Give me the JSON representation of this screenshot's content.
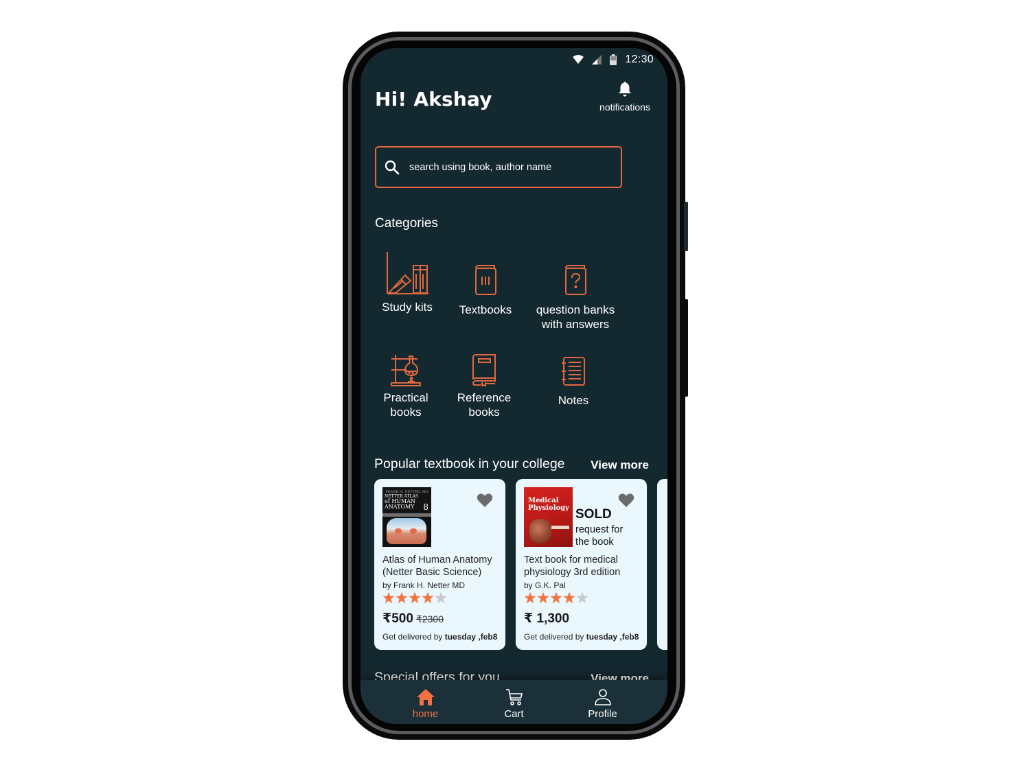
{
  "status_bar": {
    "time": "12:30",
    "icons": [
      "wifi-icon",
      "cell-signal-icon",
      "battery-icon"
    ]
  },
  "header": {
    "greeting": "Hi! Akshay",
    "notifications_label": "notifications",
    "notifications_icon": "bell-icon"
  },
  "search": {
    "placeholder": "search using book, author name",
    "value": "",
    "icon": "search-icon"
  },
  "categories": {
    "title": "Categories",
    "items": [
      {
        "label_line1": "Study kits",
        "label_line2": "",
        "icon": "books-shelf-icon"
      },
      {
        "label_line1": "Textbooks",
        "label_line2": "",
        "icon": "textbook-icon"
      },
      {
        "label_line1": "question banks",
        "label_line2": "with answers",
        "icon": "question-book-icon"
      },
      {
        "label_line1": "Practical",
        "label_line2": "books",
        "icon": "lab-flask-icon"
      },
      {
        "label_line1": "Reference",
        "label_line2": "books",
        "icon": "reference-book-icon"
      },
      {
        "label_line1": "Notes",
        "label_line2": "",
        "icon": "notepad-icon"
      }
    ]
  },
  "popular": {
    "title": "Popular textbook in your college",
    "view_more": "View more",
    "books": [
      {
        "title": "Atlas of Human Anatomy (Netter Basic Science)",
        "author": "by Frank H. Netter MD",
        "rating": 4,
        "rating_max": 5,
        "price": "₹500",
        "old_price": "₹2300",
        "delivery_prefix": "Get delivered by ",
        "delivery_date": "tuesday ,feb8",
        "cover_text": [
          "NETTER ATLAS",
          "of HUMAN",
          "ANATOMY",
          "8"
        ],
        "sold": false
      },
      {
        "title": "Text book for medical physiology 3rd edition",
        "author": "by G.K. Pal",
        "rating": 4,
        "rating_max": 5,
        "price": "₹ 1,300",
        "old_price": "",
        "delivery_prefix": "Get delivered by ",
        "delivery_date": "tuesday ,feb8",
        "cover_text": [
          "Medical",
          "Physiology"
        ],
        "sold": true,
        "sold_label": "SOLD",
        "request_label": "request for the book"
      }
    ]
  },
  "special_offers": {
    "title": "Special offers for you",
    "view_more": "View more"
  },
  "bottom_nav": {
    "items": [
      {
        "label": "home",
        "icon": "home-icon",
        "active": true
      },
      {
        "label": "Cart",
        "icon": "cart-icon",
        "active": false
      },
      {
        "label": "Profile",
        "icon": "profile-icon",
        "active": false
      }
    ]
  },
  "colors": {
    "accent": "#f27243",
    "background": "#142830",
    "card": "#eaf7fd",
    "star_empty": "#c8c8c8",
    "heart": "#6b6b6b"
  }
}
